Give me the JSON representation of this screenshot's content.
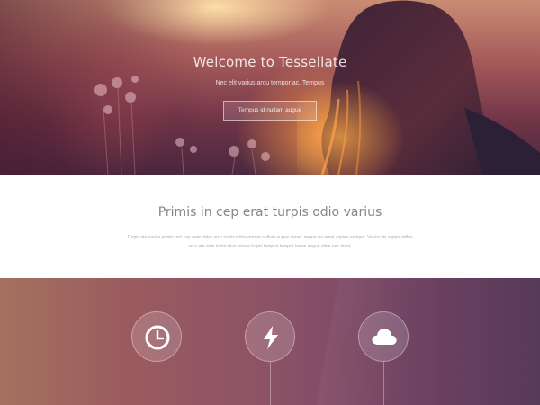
{
  "hero": {
    "title": "Welcome to Tessellate",
    "subtitle": "Nec elit varius arcu tempor ac. Tempus",
    "button_label": "Tempus id nullam augue"
  },
  "intro": {
    "title": "Primis in cep erat turpis odio varius",
    "text": "Turpis ata varius primis orci cep ante tortor arcu sociis tellus ornare nullam augue donec neque vis amet sapien semper. Varius vis sapien tellus arcu ata ante tortor duis ornare turpis tempus tempor lorem augue vitae nec dolor."
  },
  "features": [
    {
      "icon": "clock-icon"
    },
    {
      "icon": "lightning-bolt-icon"
    },
    {
      "icon": "cloud-icon"
    }
  ],
  "colors": {
    "hero_dark": "#4a2840",
    "hero_warm": "#f59646",
    "intro_title": "#8d8486",
    "intro_text": "#b0a8aa",
    "features_left": "#a4715f",
    "features_right": "#573a58"
  }
}
